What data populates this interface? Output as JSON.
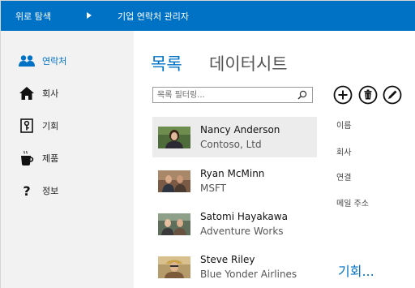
{
  "topbar": {
    "back_label": "위로 탐색",
    "app_title": "기업 연락처 관리자",
    "color": "#0072c6"
  },
  "sidebar": {
    "items": [
      {
        "label": "연락처",
        "icon": "people-icon",
        "active": true
      },
      {
        "label": "회사",
        "icon": "house-icon",
        "active": false
      },
      {
        "label": "기회",
        "icon": "key-icon",
        "active": false
      },
      {
        "label": "제품",
        "icon": "coffee-cup-icon",
        "active": false
      },
      {
        "label": "정보",
        "icon": "question-icon",
        "active": false
      }
    ]
  },
  "main": {
    "tabs": [
      {
        "label": "목록",
        "active": true
      },
      {
        "label": "데이터시트",
        "active": false
      }
    ],
    "search": {
      "placeholder": "목록 필터링...",
      "value": ""
    },
    "actions": [
      {
        "name": "add-button",
        "icon": "plus-circle-icon"
      },
      {
        "name": "delete-button",
        "icon": "trash-circle-icon"
      },
      {
        "name": "edit-button",
        "icon": "pencil-circle-icon"
      }
    ],
    "contacts": [
      {
        "name": "Nancy Anderson",
        "company": "Contoso, Ltd",
        "selected": true
      },
      {
        "name": "Ryan McMinn",
        "company": "MSFT",
        "selected": false
      },
      {
        "name": "Satomi Hayakawa",
        "company": "Adventure Works",
        "selected": false
      },
      {
        "name": "Steve Riley",
        "company": "Blue Yonder Airlines",
        "selected": false
      }
    ],
    "fields": [
      "이름",
      "회사",
      "연결",
      "메일 주소"
    ],
    "more_label": "기회..."
  }
}
